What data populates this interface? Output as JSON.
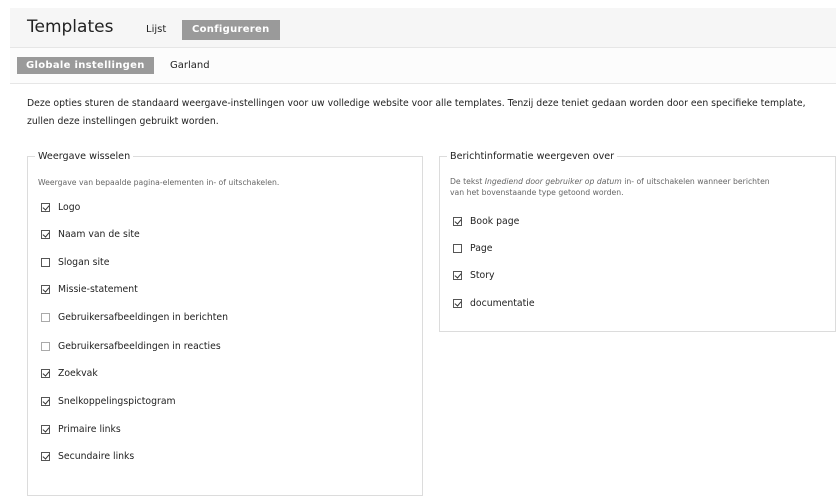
{
  "header": {
    "title": "Templates",
    "tabs": [
      {
        "label": "Lijst",
        "active": false
      },
      {
        "label": "Configureren",
        "active": true
      }
    ]
  },
  "subtabs": [
    {
      "label": "Globale instellingen",
      "active": true
    },
    {
      "label": "Garland",
      "active": false
    }
  ],
  "description": "Deze opties sturen de standaard weergave-instellingen voor uw volledige website voor alle templates. Tenzij deze teniet gedaan worden door een specifieke template, zullen deze instellingen gebruikt worden.",
  "toggle_display": {
    "legend": "Weergave wisselen",
    "description": "Weergave van bepaalde pagina-elementen in- of uitschakelen.",
    "options": [
      {
        "label": "Logo",
        "checked": true
      },
      {
        "label": "Naam van de site",
        "checked": true
      },
      {
        "label": "Slogan site",
        "checked": false
      },
      {
        "label": "Missie-statement",
        "checked": true
      },
      {
        "label": "Gebruikersafbeeldingen in berichten",
        "checked": false
      },
      {
        "label": "Gebruikersafbeeldingen in reacties",
        "checked": false
      },
      {
        "label": "Zoekvak",
        "checked": true
      },
      {
        "label": "Snelkoppelingspictogram",
        "checked": true
      },
      {
        "label": "Primaire links",
        "checked": true
      },
      {
        "label": "Secundaire links",
        "checked": true
      }
    ]
  },
  "post_info": {
    "legend": "Berichtinformatie weergeven over",
    "description_prefix": "De tekst ",
    "description_emphasis": "Ingediend door gebruiker op datum",
    "description_suffix": " in- of uitschakelen wanneer berichten van het bovenstaande type getoond worden.",
    "options": [
      {
        "label": "Book page",
        "checked": true
      },
      {
        "label": "Page",
        "checked": false
      },
      {
        "label": "Story",
        "checked": true
      },
      {
        "label": "documentatie",
        "checked": true
      }
    ]
  }
}
